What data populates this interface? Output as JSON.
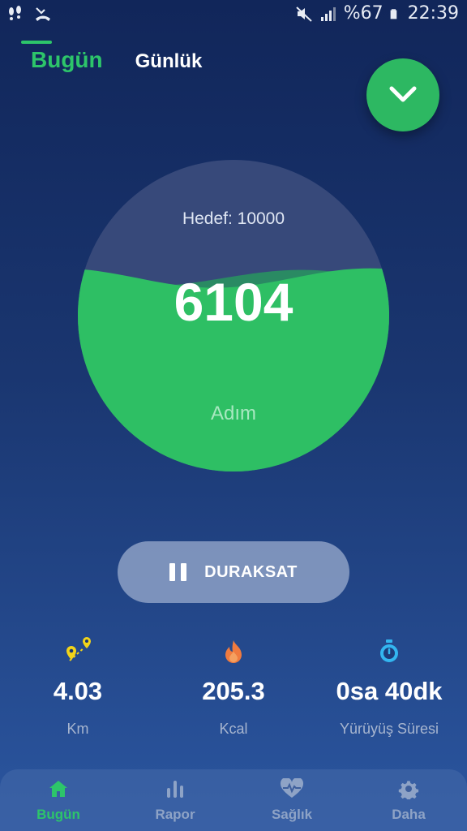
{
  "status_bar": {
    "battery": "%67",
    "time": "22:39"
  },
  "tabs": [
    {
      "label": "Bugün",
      "active": true
    },
    {
      "label": "Günlük",
      "active": false
    }
  ],
  "gauge": {
    "goal_label": "Hedef: 10000",
    "steps": "6104",
    "unit": "Adım",
    "progress": 0.6104
  },
  "pause_button": {
    "label": "DURAKSAT"
  },
  "stats": [
    {
      "value": "4.03",
      "label": "Km",
      "icon": "route-pin-icon"
    },
    {
      "value": "205.3",
      "label": "Kcal",
      "icon": "flame-icon"
    },
    {
      "value": "0sa 40dk",
      "label": "Yürüyüş Süresi",
      "icon": "stopwatch-icon"
    }
  ],
  "bottom_nav": [
    {
      "label": "Bugün",
      "icon": "home-icon",
      "active": true
    },
    {
      "label": "Rapor",
      "icon": "bar-chart-icon",
      "active": false
    },
    {
      "label": "Sağlık",
      "icon": "heart-pulse-icon",
      "active": false
    },
    {
      "label": "Daha",
      "icon": "gear-icon",
      "active": false
    }
  ],
  "colors": {
    "accent": "#2dc56a",
    "background_top": "#11265a",
    "background_bottom": "#2b56a0",
    "flame": "#f07b3f",
    "pin": "#f2d419",
    "stopwatch": "#33b6f0"
  }
}
